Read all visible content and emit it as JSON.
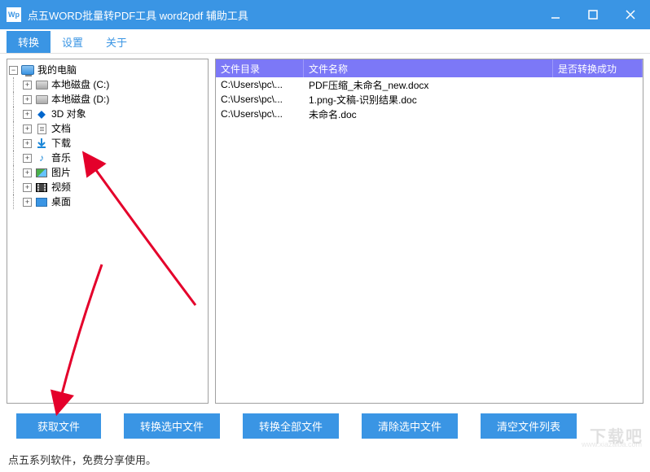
{
  "window": {
    "title": "点五WORD批量转PDF工具 word2pdf 辅助工具",
    "app_icon_text": "Wp"
  },
  "menu": {
    "items": [
      "转换",
      "设置",
      "关于"
    ],
    "active_index": 0
  },
  "tree": {
    "root": {
      "label": "我的电脑",
      "expanded": true
    },
    "children": [
      {
        "label": "本地磁盘 (C:)",
        "icon": "disk"
      },
      {
        "label": "本地磁盘 (D:)",
        "icon": "disk"
      },
      {
        "label": "3D 对象",
        "icon": "3d"
      },
      {
        "label": "文档",
        "icon": "doc"
      },
      {
        "label": "下载",
        "icon": "down"
      },
      {
        "label": "音乐",
        "icon": "music"
      },
      {
        "label": "图片",
        "icon": "pic"
      },
      {
        "label": "视频",
        "icon": "vid"
      },
      {
        "label": "桌面",
        "icon": "desk"
      }
    ]
  },
  "list": {
    "headers": {
      "dir": "文件目录",
      "name": "文件名称",
      "status": "是否转换成功"
    },
    "rows": [
      {
        "dir": "C:\\Users\\pc\\...",
        "name": "PDF压缩_未命名_new.docx",
        "status": ""
      },
      {
        "dir": "C:\\Users\\pc\\...",
        "name": "1.png-文稿-识别结果.doc",
        "status": ""
      },
      {
        "dir": "C:\\Users\\pc\\...",
        "name": "未命名.doc",
        "status": ""
      }
    ]
  },
  "buttons": {
    "get_files": "获取文件",
    "convert_selected": "转换选中文件",
    "convert_all": "转换全部文件",
    "clear_selected": "清除选中文件",
    "clear_list": "清空文件列表"
  },
  "footer": {
    "text": "点五系列软件，免费分享使用。"
  },
  "watermark": {
    "main": "下载吧",
    "sub": "www.xiazaiba.com"
  }
}
